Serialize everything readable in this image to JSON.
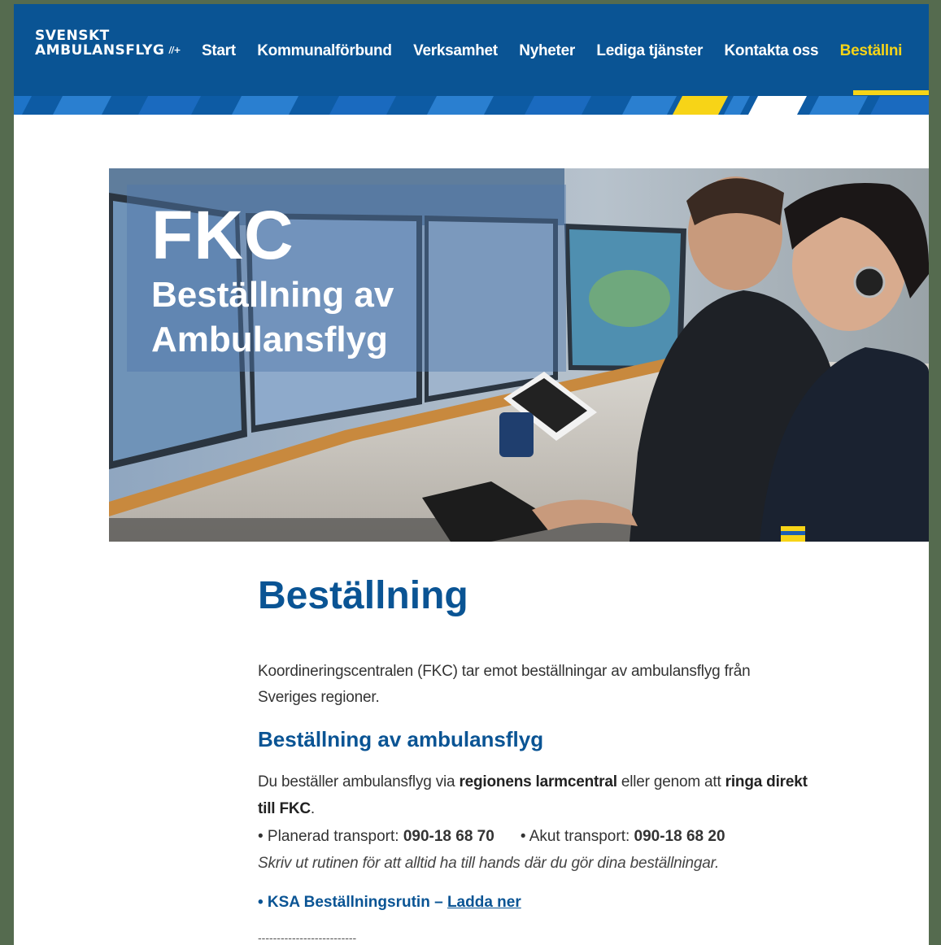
{
  "brand": {
    "line1": "SVENSKT",
    "line2": "AMBULANSFLYG",
    "mark": "//+"
  },
  "nav": {
    "items": [
      {
        "label": "Start"
      },
      {
        "label": "Kommunalförbund"
      },
      {
        "label": "Verksamhet"
      },
      {
        "label": "Nyheter"
      },
      {
        "label": "Lediga tjänster"
      },
      {
        "label": "Kontakta oss"
      },
      {
        "label": "Beställni",
        "active": true
      }
    ]
  },
  "colors": {
    "header_bg": "#0a5494",
    "accent_yellow": "#f7d417",
    "heading_blue": "#0a5494"
  },
  "hero": {
    "title": "FKC",
    "subtitle": "Beställning av Ambulansflyg"
  },
  "main": {
    "heading": "Beställning",
    "intro": "Koordineringscentralen (FKC) tar emot beställningar av ambulansflyg från Sveriges regioner.",
    "section_heading": "Beställning av ambulansflyg",
    "order_text_1": "Du beställer ambulansflyg via ",
    "order_bold_1": "regionens larmcentral",
    "order_text_2": " eller genom att ",
    "order_bold_2": "ringa direkt till FKC",
    "order_text_3": ".",
    "planned_label": "• Planerad transport: ",
    "planned_number": "090-18 68 70",
    "acute_label": "• Akut transport: ",
    "acute_number": "090-18 68 20",
    "note": "Skriv ut rutinen för att alltid ha till hands där du gör dina beställningar.",
    "ksa_label": "• KSA Beställningsrutin – ",
    "ksa_link": "Ladda ner",
    "divider": "--------------------------"
  }
}
